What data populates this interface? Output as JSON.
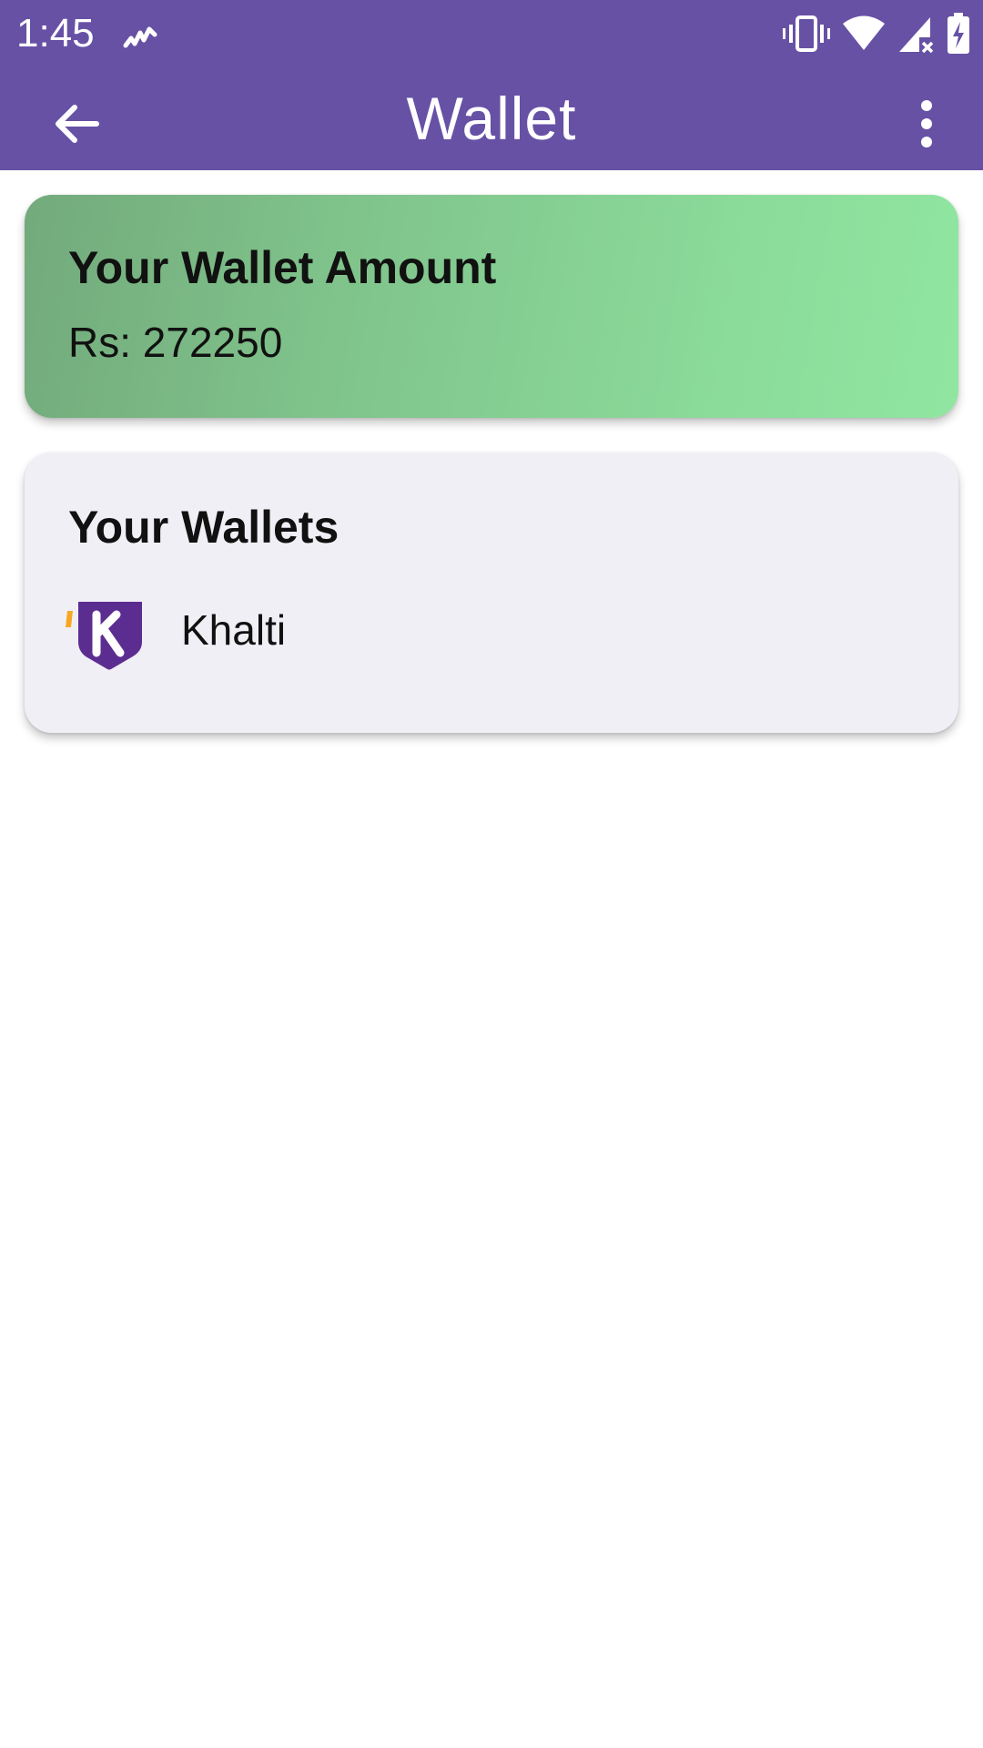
{
  "status_bar": {
    "time": "1:45",
    "icons": [
      "activity-icon",
      "vibrate-icon",
      "wifi-icon",
      "signal-no-data-icon",
      "battery-charging-icon"
    ]
  },
  "toolbar": {
    "title": "Wallet",
    "back_icon": "arrow-back-icon",
    "menu_icon": "more-vert-icon"
  },
  "amount_card": {
    "title": "Your Wallet Amount",
    "amount": "Rs: 272250"
  },
  "wallets_card": {
    "title": "Your Wallets",
    "items": [
      {
        "name": "Khalti",
        "logo": "khalti-logo-icon"
      }
    ]
  },
  "colors": {
    "app_bar": "#6751a5",
    "amount_gradient_start": "#73aa7c",
    "amount_gradient_end": "#90e6a0",
    "wallets_card_bg": "#f1eff6",
    "khalti_purple": "#5c2d91",
    "khalti_orange": "#f7a823"
  }
}
